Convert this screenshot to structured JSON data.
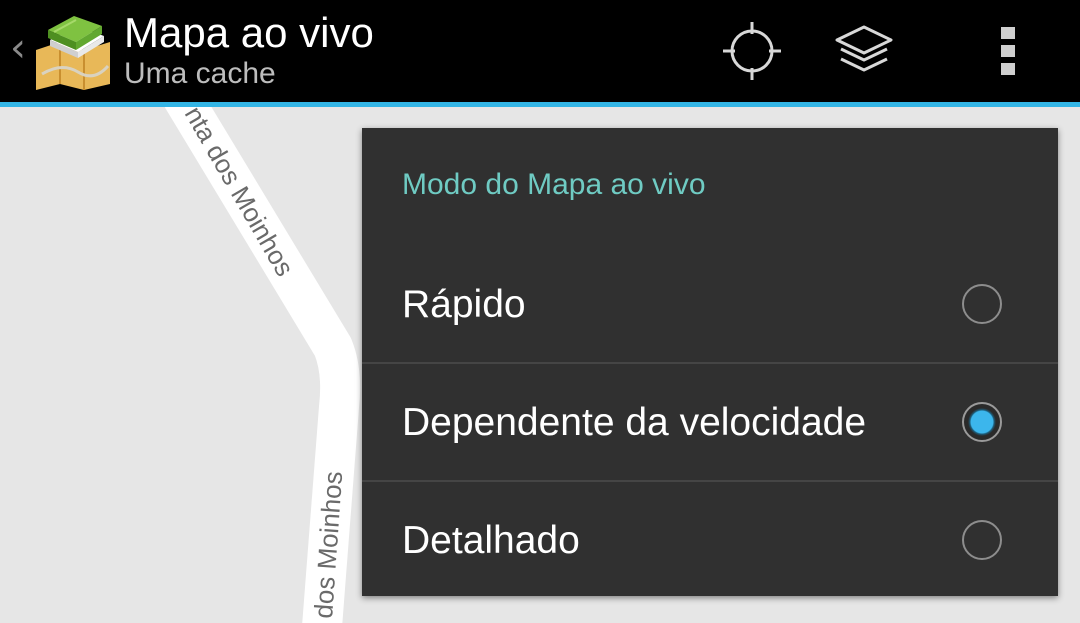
{
  "action_bar": {
    "title": "Mapa ao vivo",
    "subtitle": "Uma cache",
    "up_caret": "‹",
    "accent_color": "#33b5e5",
    "actions": [
      {
        "icon": "my-location-icon"
      },
      {
        "icon": "layers-icon"
      },
      {
        "icon": "overflow-menu-icon"
      }
    ]
  },
  "map": {
    "street_label_top": "nta dos Moinhos",
    "street_label_bottom": "dos Moinhos"
  },
  "menu": {
    "title": "Modo do Mapa ao vivo",
    "title_color": "#6fcbc3",
    "options": [
      {
        "label": "Rápido",
        "selected": false
      },
      {
        "label": "Dependente da velocidade",
        "selected": true
      },
      {
        "label": "Detalhado",
        "selected": false
      }
    ]
  }
}
